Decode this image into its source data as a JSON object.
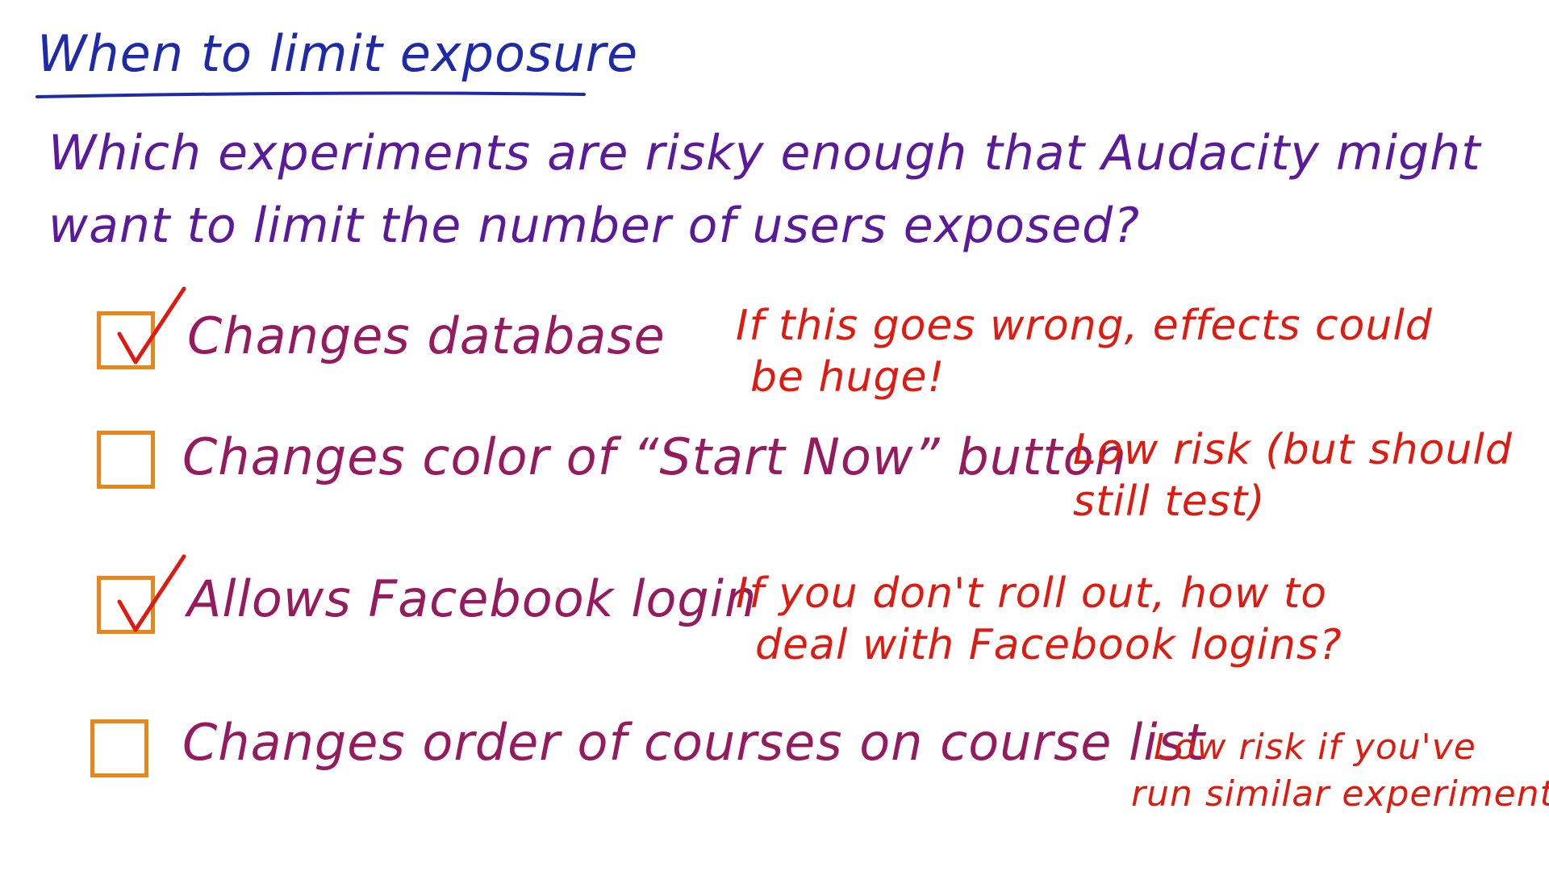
{
  "title": "When to limit exposure",
  "question": {
    "line1": "Which experiments are risky enough that Audacity might",
    "line2": "want to limit the number of users exposed?"
  },
  "colors": {
    "title": "#1f2aa8",
    "question": "#5a1a9a",
    "option": "#951a5e",
    "note": "#dd1b10",
    "checkbox": "#e8861c"
  },
  "options": [
    {
      "label": "Changes database",
      "checked": true,
      "note_line1": "If this goes wrong, effects could",
      "note_line2": "be huge!"
    },
    {
      "label": "Changes color of “Start Now” button",
      "checked": false,
      "note_line1": "Low risk (but should",
      "note_line2": "still test)"
    },
    {
      "label": "Allows Facebook login",
      "checked": true,
      "note_line1": "If you don't roll out, how to",
      "note_line2": "deal with Facebook logins?"
    },
    {
      "label": "Changes order of courses on course list",
      "checked": false,
      "note_line1": "Low risk if you've",
      "note_line2": "run similar experiments"
    }
  ]
}
